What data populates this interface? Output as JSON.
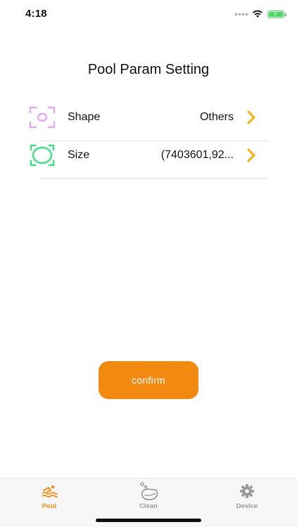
{
  "status_bar": {
    "time": "4:18"
  },
  "page": {
    "title": "Pool Param Setting"
  },
  "params": [
    {
      "label": "Shape",
      "value": "Others",
      "icon": "shape-frame-icon"
    },
    {
      "label": "Size",
      "value": "(7403601,92...",
      "icon": "size-ellipse-icon"
    }
  ],
  "confirm_label": "confirm",
  "tabs": [
    {
      "label": "Pool",
      "icon": "swimmer-icon",
      "active": true
    },
    {
      "label": "Clean",
      "icon": "soap-icon",
      "active": false
    },
    {
      "label": "Device",
      "icon": "gear-icon",
      "active": false
    }
  ],
  "colors": {
    "accent": "#f28a12",
    "chevron": "#f2b31b",
    "shape_icon": "#e7a7f5",
    "size_icon": "#3fde82",
    "inactive_tab": "#9a9a9a"
  }
}
